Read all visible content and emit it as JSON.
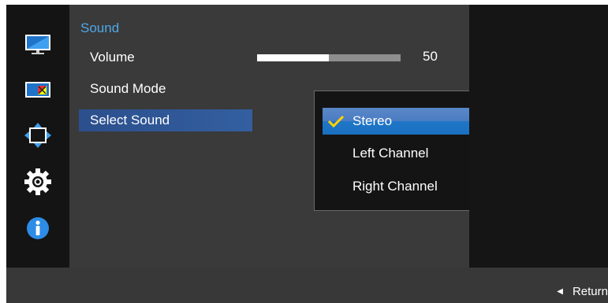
{
  "sidebar": {
    "icons": [
      {
        "name": "picture-icon"
      },
      {
        "name": "screen-adjust-icon"
      },
      {
        "name": "position-size-icon"
      },
      {
        "name": "settings-icon"
      },
      {
        "name": "information-icon"
      }
    ]
  },
  "menu": {
    "title": "Sound",
    "items": [
      {
        "label": "Volume"
      },
      {
        "label": "Sound Mode"
      },
      {
        "label": "Select Sound"
      }
    ],
    "volume": {
      "value": "50",
      "level": 0.5
    }
  },
  "popup": {
    "options": [
      {
        "label": "Stereo",
        "selected": true
      },
      {
        "label": "Left Channel",
        "selected": false
      },
      {
        "label": "Right Channel",
        "selected": false
      }
    ]
  },
  "footer": {
    "return_label": "Return"
  },
  "colors": {
    "accent_blue": "#4ea8ea",
    "selection_blue": "#1f76c7",
    "check_yellow": "#ffd400"
  }
}
